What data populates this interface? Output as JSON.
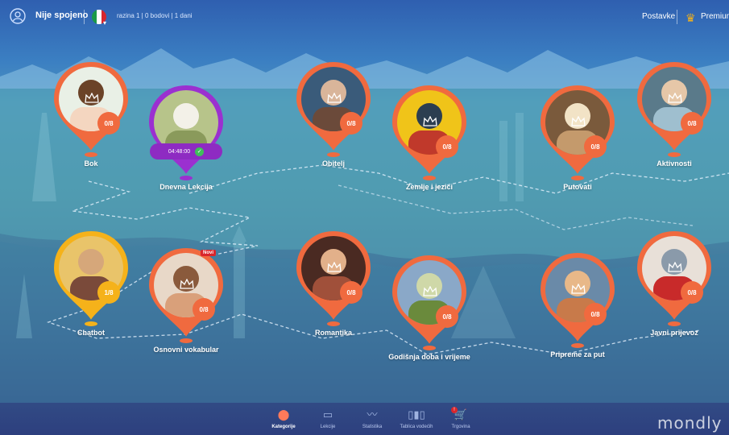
{
  "topbar": {
    "user_status": "Nije spojeno",
    "stats": "razina 1  |  0 bodovi  |  1 dani",
    "settings_label": "Postavke",
    "premium_label": "Premium",
    "flag_colors": [
      "#1b9a47",
      "#ffffff",
      "#d6262e"
    ]
  },
  "colors": {
    "pin_orange": "#f06a3f",
    "pin_purple": "#9b30d0",
    "pin_yellow": "#f5b21a"
  },
  "lessons": [
    {
      "label": "Bok",
      "progress": "0/8",
      "style": "orange",
      "photo": "woman-portrait"
    },
    {
      "label": "Dnevna Lekcija",
      "timer": "04:48:00",
      "style": "purple",
      "photo": "calendar"
    },
    {
      "label": "Obitelj",
      "progress": "0/8",
      "style": "orange",
      "photo": "family"
    },
    {
      "label": "Zemlje i jezici",
      "progress": "0/8",
      "style": "orange",
      "photo": "flags-crowd"
    },
    {
      "label": "Putovati",
      "progress": "0/8",
      "style": "orange",
      "photo": "traveler-map"
    },
    {
      "label": "Aktivnosti",
      "progress": "0/8",
      "style": "orange",
      "photo": "couple-selfie"
    },
    {
      "label": "Chatbot",
      "progress": "1/8",
      "style": "yellow",
      "photo": "friends-phone"
    },
    {
      "label": "Osnovni vokabular",
      "progress": "0/8",
      "style": "orange",
      "photo": "kids",
      "tag": "Novi"
    },
    {
      "label": "Romantika",
      "progress": "0/8",
      "style": "orange",
      "photo": "couple-hug"
    },
    {
      "label": "Godišnja doba i vrijeme",
      "progress": "0/8",
      "style": "orange",
      "photo": "tree-seasons"
    },
    {
      "label": "Pripreme za put",
      "progress": "0/8",
      "style": "orange",
      "photo": "hiker-canyon"
    },
    {
      "label": "Javni prijevoz",
      "progress": "0/8",
      "style": "orange",
      "photo": "red-bus"
    }
  ],
  "bottom_nav": [
    {
      "label": "Kategorije",
      "icon": "map-icon",
      "active": true
    },
    {
      "label": "Lekcije",
      "icon": "book-icon",
      "active": false
    },
    {
      "label": "Statistika",
      "icon": "chart-line-icon",
      "active": false
    },
    {
      "label": "Tablica vodećih",
      "icon": "bar-chart-icon",
      "active": false
    },
    {
      "label": "Trgovina",
      "icon": "cart-icon",
      "active": false,
      "badge": "!"
    }
  ],
  "logo": "mondly"
}
